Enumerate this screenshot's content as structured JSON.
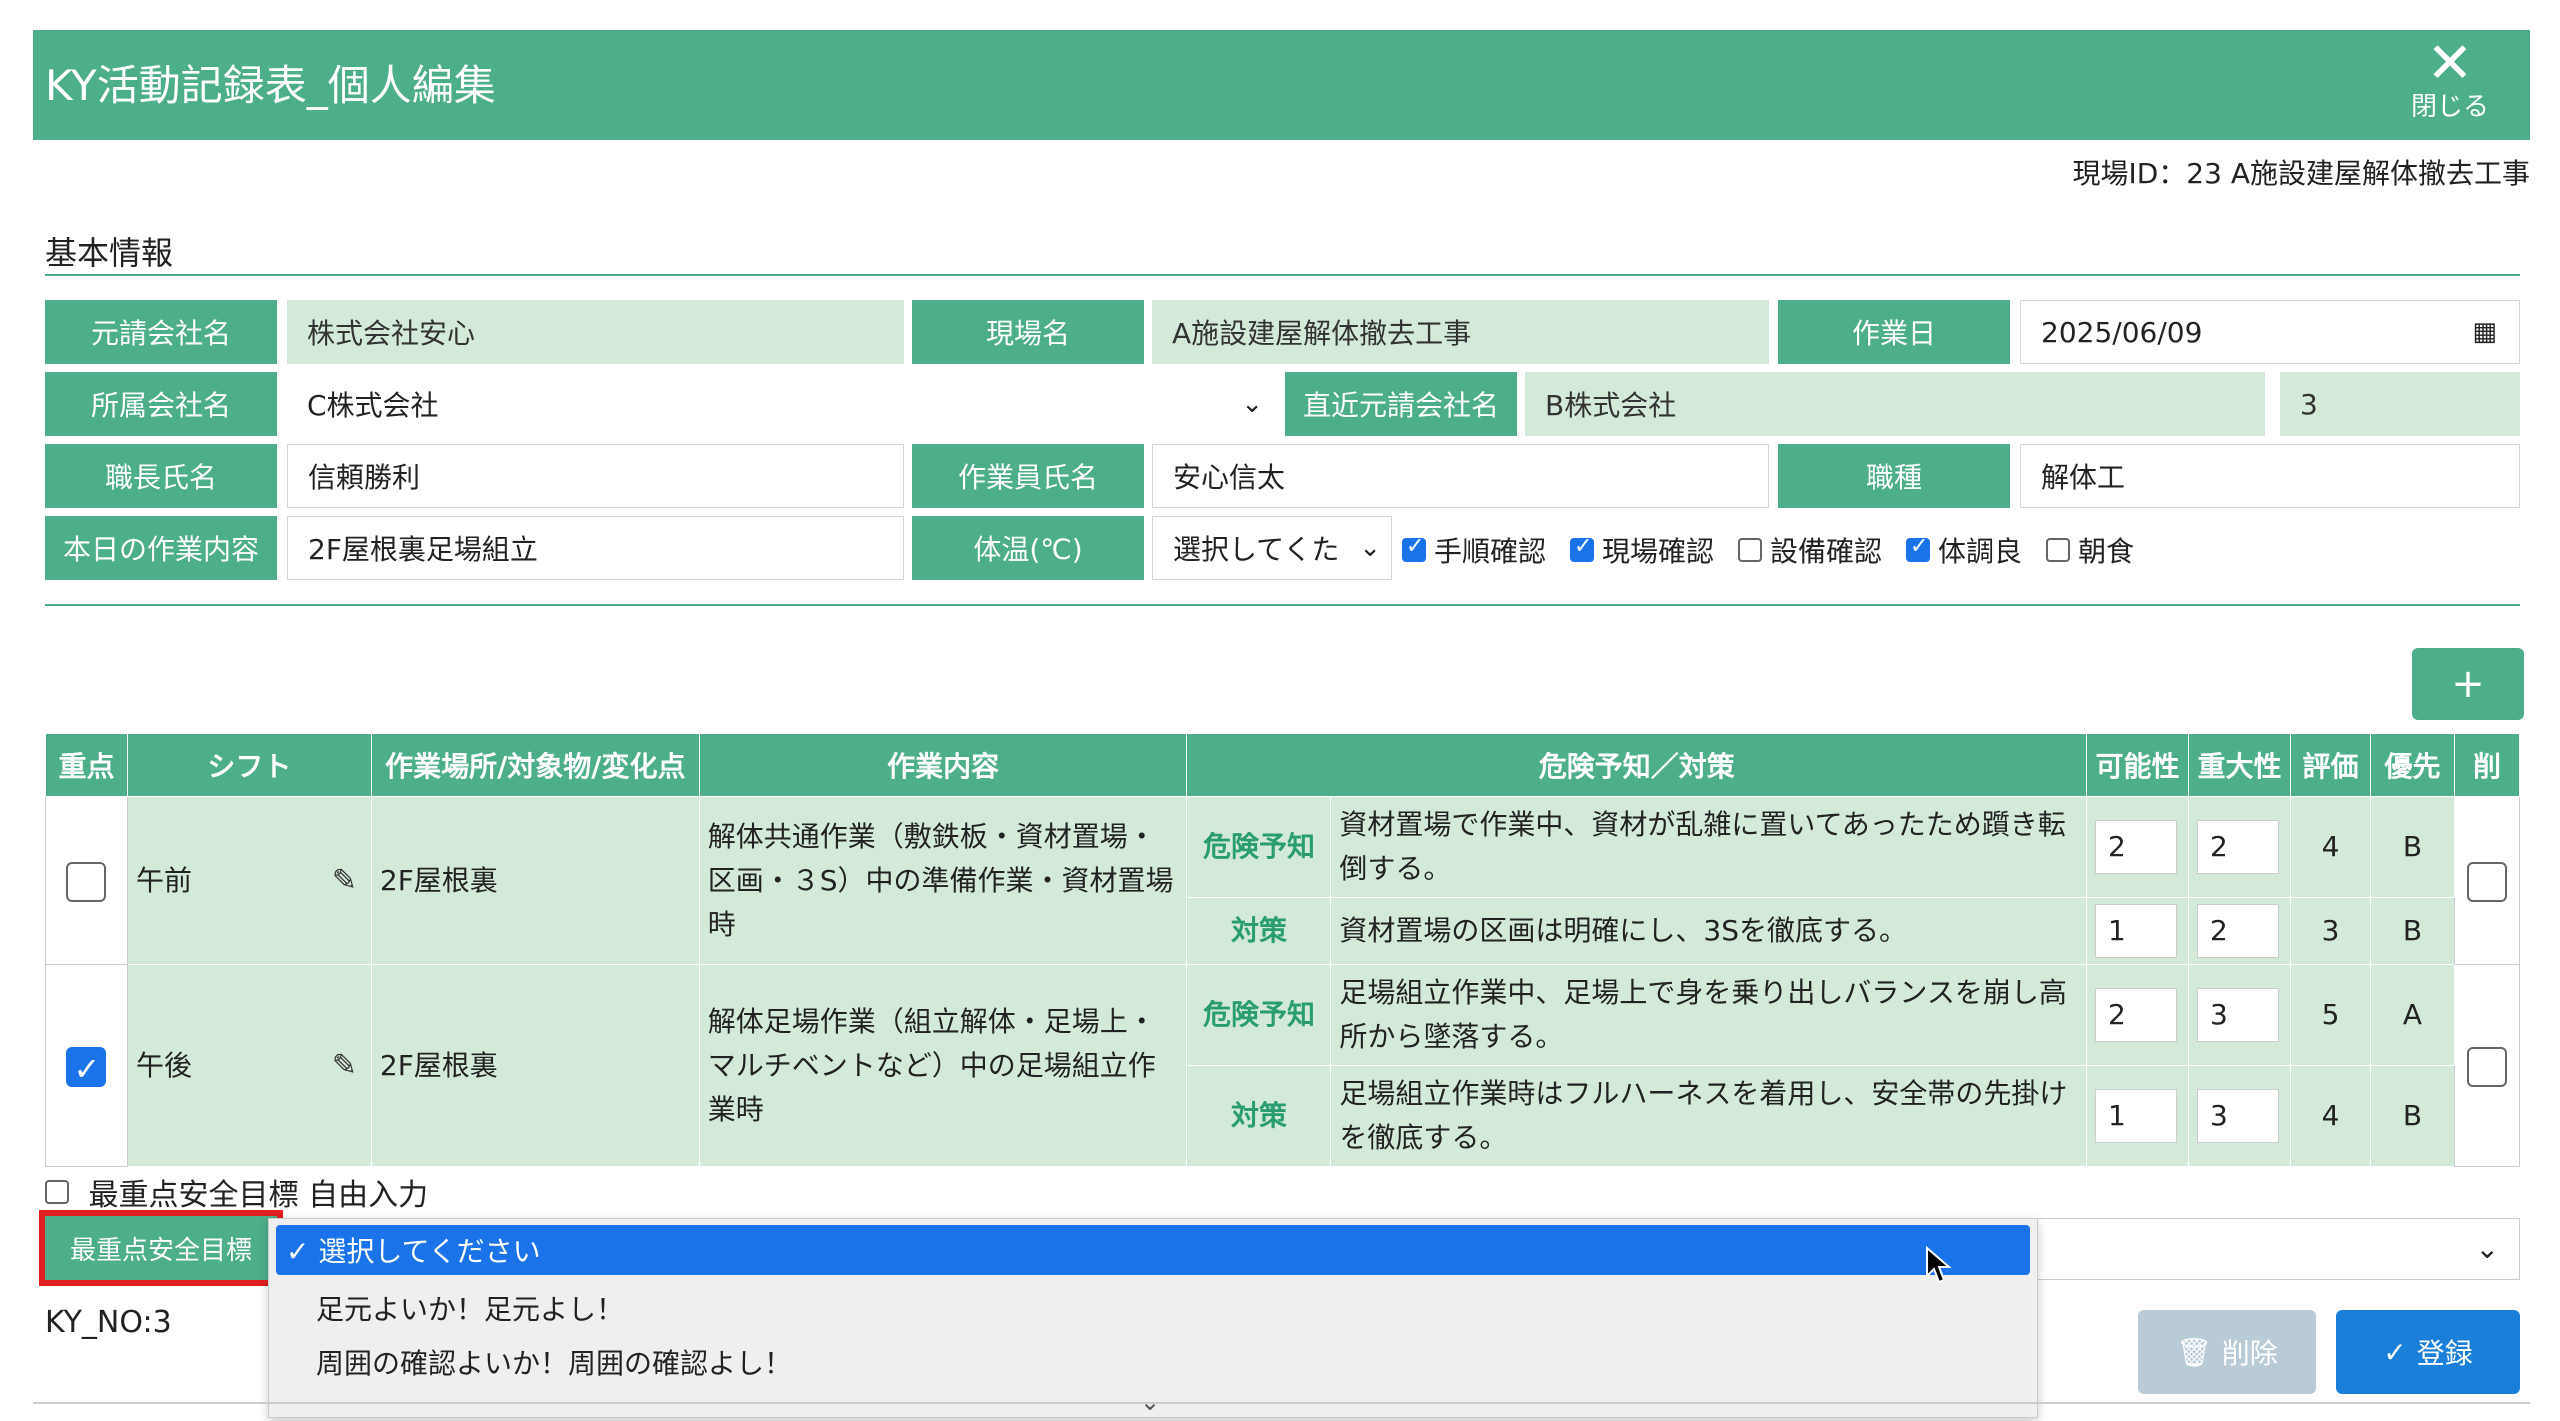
{
  "header": {
    "title": "KY活動記録表_個人編集",
    "close_label": "閉じる"
  },
  "site_id": "現場ID：23 A施設建屋解体撤去工事",
  "section": {
    "basic_info": "基本情報"
  },
  "form": {
    "prime_company_label": "元請会社名",
    "prime_company_value": "株式会社安心",
    "site_name_label": "現場名",
    "site_name_value": "A施設建屋解体撤去工事",
    "work_date_label": "作業日",
    "work_date_value": "2025/06/09",
    "affiliated_label": "所属会社名",
    "affiliated_value": "C株式会社",
    "direct_prime_label": "直近元請会社名",
    "direct_prime_value": "B株式会社",
    "direct_prime_num": "3",
    "foreman_label": "職長氏名",
    "foreman_value": "信頼勝利",
    "worker_label": "作業員氏名",
    "worker_value": "安心信太",
    "trade_label": "職種",
    "trade_value": "解体工",
    "task_label": "本日の作業内容",
    "task_value": "2F屋根裏足場組立",
    "temp_label": "体温(℃)",
    "temp_value": "選択してくた",
    "checks": [
      {
        "label": "手順確認",
        "checked": true
      },
      {
        "label": "現場確認",
        "checked": true
      },
      {
        "label": "設備確認",
        "checked": false
      },
      {
        "label": "体調良",
        "checked": true
      },
      {
        "label": "朝食",
        "checked": false
      }
    ]
  },
  "add_button": "+",
  "table": {
    "headers": [
      "重点",
      "シフト",
      "作業場所/対象物/変化点",
      "作業内容",
      "危険予知／対策",
      "可能性",
      "重大性",
      "評価",
      "優先",
      "削"
    ],
    "rows": [
      {
        "shift": "午前",
        "place": "2F屋根裏",
        "content": "解体共通作業（敷鉄板・資材置場・区画・３S）中の準備作業・資材置場時",
        "danger_tag": "危険予知",
        "danger": "資材置場で作業中、資材が乱雑に置いてあったため躓き転倒する。",
        "danger_p": "2",
        "danger_s": "2",
        "danger_e": "4",
        "danger_r": "B",
        "measure_tag": "対策",
        "measure": "資材置場の区画は明確にし、3Sを徹底する。",
        "measure_p": "1",
        "measure_s": "2",
        "measure_e": "3",
        "measure_r": "B"
      },
      {
        "shift": "午後",
        "place": "2F屋根裏",
        "content": "解体足場作業（組立解体・足場上・マルチベントなど）中の足場組立作業時",
        "danger_tag": "危険予知",
        "danger": "足場組立作業中、足場上で身を乗り出しバランスを崩し高所から墜落する。",
        "danger_p": "2",
        "danger_s": "3",
        "danger_e": "5",
        "danger_r": "A",
        "measure_tag": "対策",
        "measure": "足場組立作業時はフルハーネスを着用し、安全帯の先掛けを徹底する。",
        "measure_p": "1",
        "measure_s": "3",
        "measure_e": "4",
        "measure_r": "B"
      }
    ]
  },
  "free_input_label": "最重点安全目標 自由入力",
  "goal": {
    "label": "最重点安全目標",
    "options": [
      "✓ 選択してください",
      "足元よいか！足元よし！",
      "周囲の確認よいか！周囲の確認よし！"
    ]
  },
  "ky_no": "KY_NO:3",
  "buttons": {
    "delete": "削除",
    "register": "登録"
  }
}
